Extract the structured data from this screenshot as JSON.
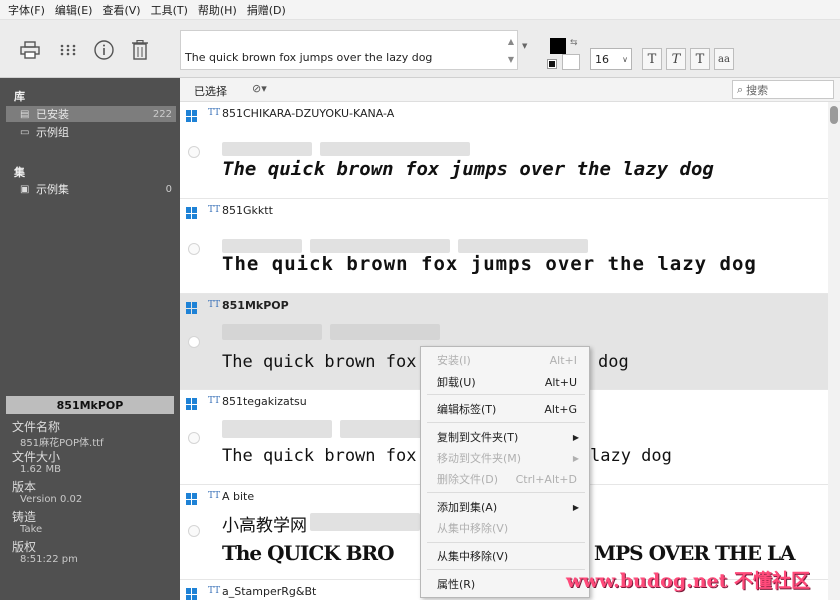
{
  "menubar": [
    "字体(F)",
    "编辑(E)",
    "查看(V)",
    "工具(T)",
    "帮助(H)",
    "捐赠(D)"
  ],
  "toolbar": {
    "preview_text": "The quick brown fox jumps over the lazy dog",
    "font_size": "16",
    "style_buttons": [
      "T",
      "T",
      "T",
      "aa"
    ],
    "colors": {
      "foreground": "#000000",
      "background": "#ffffff"
    }
  },
  "sidebar": {
    "library_heading": "库",
    "installed": {
      "label": "已安装",
      "count": "222"
    },
    "example_group": "示例组",
    "collections_heading": "集",
    "example_collection": {
      "label": "示例集",
      "count": "0"
    },
    "detail": {
      "title": "851MkPOP",
      "file_name_label": "文件名称",
      "file_name": "851麻花POP体.ttf",
      "file_size_label": "文件大小",
      "file_size": "1.62 MB",
      "version_label": "版本",
      "version": "Version 0.02",
      "maker_label": "铸造",
      "maker": "Take",
      "copyright_label": "版权",
      "copyright": "8:51:22 pm"
    }
  },
  "listbar": {
    "selected_label": "已选择",
    "tag_icon": "tag-icon",
    "search_placeholder": "搜索"
  },
  "fonts": [
    {
      "name": "851CHIKARA-DZUYOKU-KANA-A",
      "sample": "The quick brown fox jumps over the lazy dog"
    },
    {
      "name": "851Gkktt",
      "sample": "The quick brown fox jumps over the lazy dog"
    },
    {
      "name": "851MkPOP",
      "sample": "The quick brown fox j",
      "sample_tail": "dog"
    },
    {
      "name": "851tegakizatsu",
      "sample": "The quick brown fox",
      "sample_tail": "lazy dog"
    },
    {
      "name": "A bite",
      "sample_cjk": "小高教学网",
      "sample": "The QUICK BRO",
      "sample_tail": "MPS OVER THE LA"
    },
    {
      "name": "a_StamperRg&Bt"
    }
  ],
  "context_menu": [
    {
      "label": "安装(I)",
      "shortcut": "Alt+I",
      "disabled": true
    },
    {
      "label": "卸载(U)",
      "shortcut": "Alt+U",
      "disabled": false
    },
    {
      "label": "编辑标签(T)",
      "shortcut": "Alt+G",
      "disabled": false
    },
    {
      "label": "复制到文件夹(T)",
      "submenu": true,
      "disabled": false
    },
    {
      "label": "移动到文件夹(M)",
      "submenu": true,
      "disabled": true
    },
    {
      "label": "删除文件(D)",
      "shortcut": "Ctrl+Alt+D",
      "disabled": true
    },
    {
      "label": "添加到集(A)",
      "submenu": true,
      "disabled": false
    },
    {
      "label": "从集中移除(V)",
      "disabled": true
    },
    {
      "label": "从集中移除(V)",
      "disabled": false
    },
    {
      "label": "属性(R)",
      "disabled": false
    }
  ],
  "watermark": "www.budog.net 不懂社区"
}
